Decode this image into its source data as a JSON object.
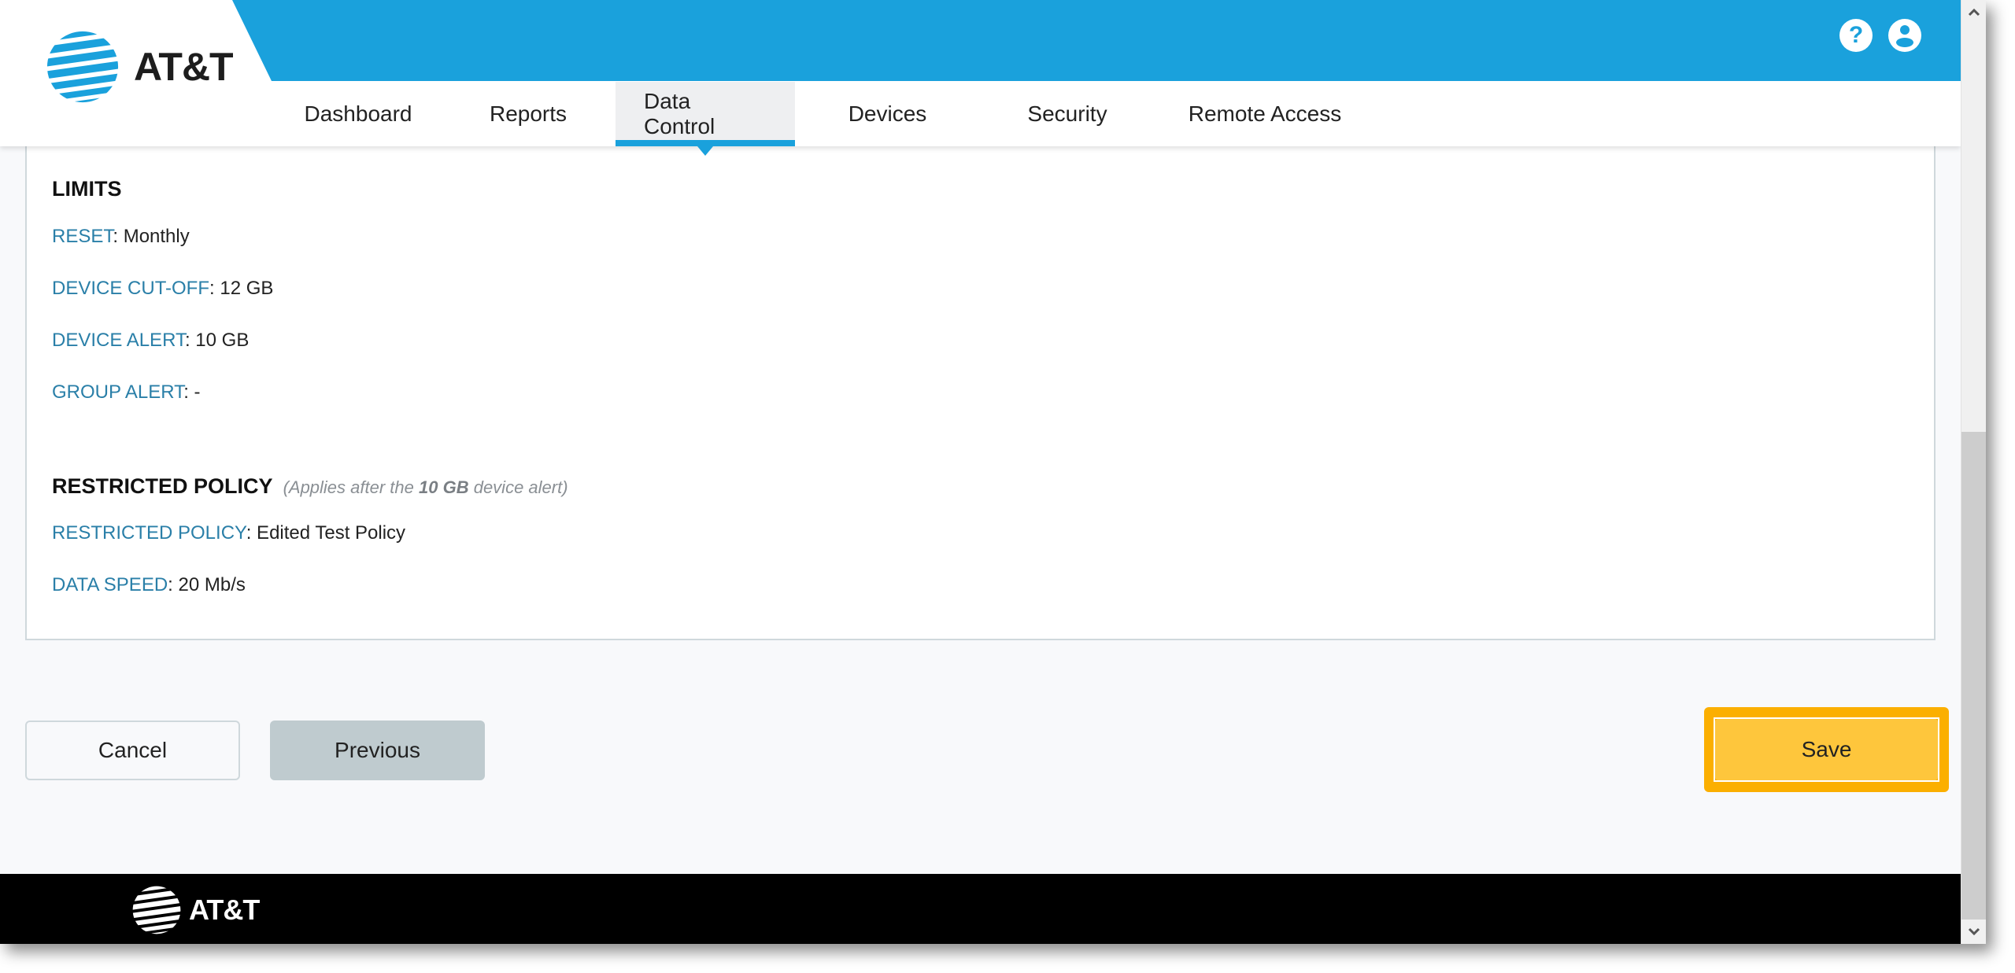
{
  "brand": {
    "name": "AT&T",
    "accent_color": "#1aa1dc",
    "highlight_color": "#fbaf00",
    "save_color": "#fec63c"
  },
  "header": {
    "icons": [
      {
        "name": "help-icon",
        "glyph": "?"
      },
      {
        "name": "user-account-icon",
        "glyph": "person"
      }
    ]
  },
  "nav": {
    "tabs": [
      {
        "label": "Dashboard",
        "active": false
      },
      {
        "label": "Reports",
        "active": false
      },
      {
        "label": "Data Control",
        "active": true
      },
      {
        "label": "Devices",
        "active": false
      },
      {
        "label": "Security",
        "active": false
      },
      {
        "label": "Remote Access",
        "active": false
      }
    ]
  },
  "limits": {
    "title": "LIMITS",
    "rows": [
      {
        "label": "RESET",
        "value": ": Monthly"
      },
      {
        "label": "DEVICE CUT-OFF",
        "value": ": 12 GB"
      },
      {
        "label": "DEVICE ALERT",
        "value": ": 10 GB"
      },
      {
        "label": "GROUP ALERT",
        "value": ": -"
      }
    ]
  },
  "restricted_policy": {
    "title": "RESTRICTED POLICY",
    "note_prefix": "(Applies after the ",
    "note_bold": "10 GB",
    "note_suffix": " device alert)",
    "rows": [
      {
        "label": "RESTRICTED POLICY",
        "value": ": Edited Test Policy"
      },
      {
        "label": "DATA SPEED",
        "value": ": 20 Mb/s"
      }
    ]
  },
  "actions": {
    "cancel_label": "Cancel",
    "previous_label": "Previous",
    "save_label": "Save"
  },
  "footer": {
    "brand": "AT&T"
  },
  "scrollbar": {
    "up_glyph": "⌃",
    "down_glyph": "⌄"
  }
}
